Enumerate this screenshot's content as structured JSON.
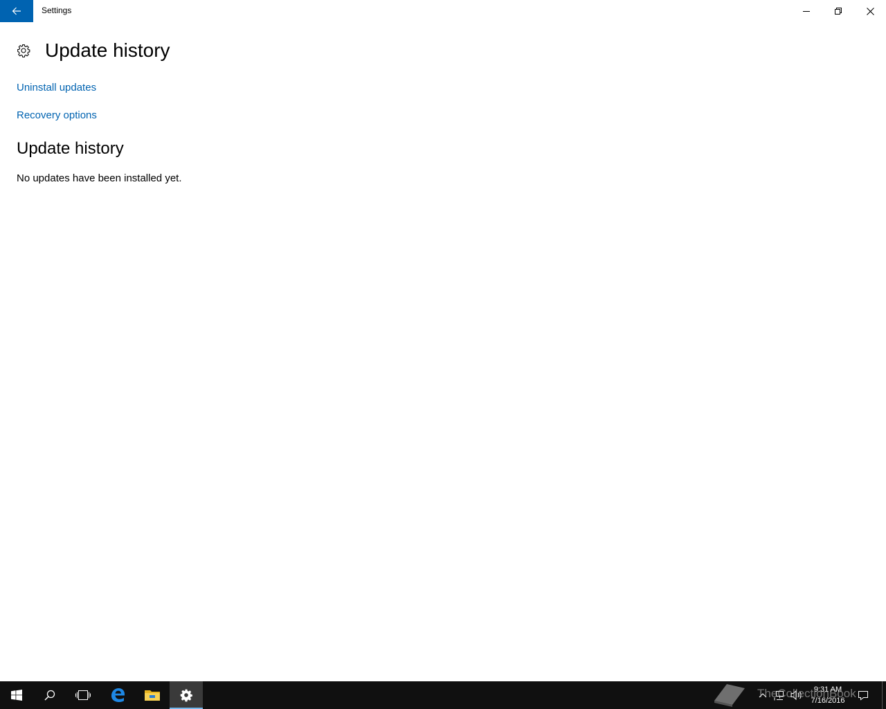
{
  "window": {
    "title": "Settings"
  },
  "page": {
    "title": "Update history",
    "links": {
      "uninstall": "Uninstall updates",
      "recovery": "Recovery options"
    },
    "section_title": "Update history",
    "empty_message": "No updates have been installed yet."
  },
  "taskbar": {
    "pinned": [
      "windows-logo-icon",
      "search-icon",
      "task-view-icon",
      "edge-icon",
      "file-explorer-icon",
      "settings-icon"
    ],
    "active_app": "settings-icon",
    "clock": {
      "time": "9:31 AM",
      "date": "7/16/2016"
    }
  },
  "watermark": {
    "text": "TheCollectionBook"
  },
  "colors": {
    "accent": "#0063b1",
    "taskbar": "#101010",
    "active_highlight": "#76b9ed"
  }
}
